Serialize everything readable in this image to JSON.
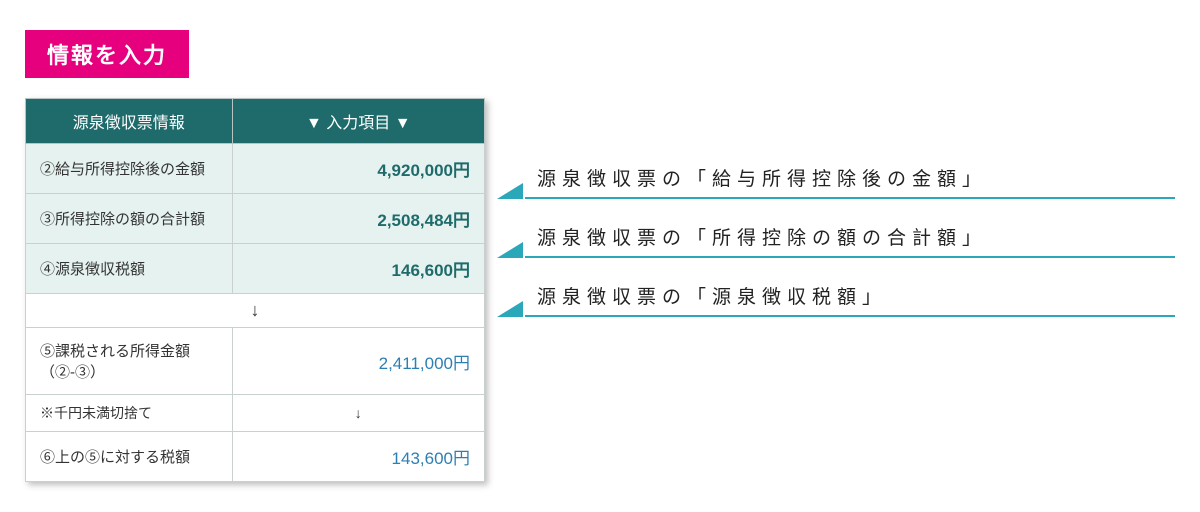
{
  "title": "情報を入力",
  "table": {
    "headers": {
      "left": "源泉徴収票情報",
      "right": "▼ 入力項目 ▼"
    },
    "rows": [
      {
        "label": "②給与所得控除後の金額",
        "value": "4,920,000円"
      },
      {
        "label": "③所得控除の額の合計額",
        "value": "2,508,484円"
      },
      {
        "label": "④源泉徴収税額",
        "value": "146,600円"
      }
    ],
    "arrow": "↓",
    "calc1": {
      "label": "⑤課税される所得金額（②-③）",
      "value": "2,411,000円"
    },
    "note": "※千円未満切捨て",
    "calc2": {
      "label": "⑥上の⑤に対する税額",
      "value": "143,600円"
    }
  },
  "callouts": [
    "源泉徴収票の「給与所得控除後の金額」",
    "源泉徴収票の「所得控除の額の合計額」",
    "源泉徴収票の「源泉徴収税額」"
  ]
}
